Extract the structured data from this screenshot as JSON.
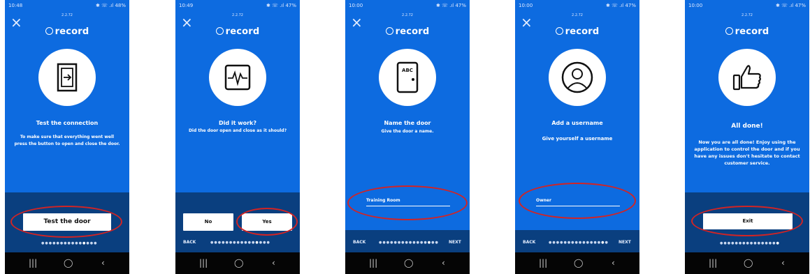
{
  "status_bar": {
    "signal_text": "✱ ☏ .ıl"
  },
  "logo_text": "record",
  "screens": [
    {
      "time": "10:48",
      "battery": "48%",
      "version": "2.2.72",
      "title": "Test the connection",
      "description": "To make sure that everything went well press the button to open and close the door.",
      "button": "Test the door"
    },
    {
      "time": "10:49",
      "battery": "47%",
      "version": "2.2.72",
      "title": "Did it work?",
      "description": "Did the door open and close as it should?",
      "no_button": "No",
      "yes_button": "Yes",
      "back": "BACK"
    },
    {
      "time": "10:00",
      "battery": "47%",
      "version": "2.2.72",
      "title": "Name the door",
      "description": "Give the door a name.",
      "door_label": "ABC",
      "input_value": "Training Room",
      "back": "BACK",
      "next": "NEXT"
    },
    {
      "time": "10:00",
      "battery": "47%",
      "version": "2.2.72",
      "title": "Add a username",
      "description": "Give yourself a username",
      "input_value": "Owner",
      "back": "BACK",
      "next": "NEXT"
    },
    {
      "time": "10:00",
      "battery": "47%",
      "version": "2.2.72",
      "title": "All done!",
      "description": "Now you are all done! Enjoy using the application to control the door and if you have any issues don't hesitate to contact customer service.",
      "button": "Exit"
    }
  ],
  "sys_nav": {
    "recent": "|||",
    "home": "◯",
    "back": "‹"
  },
  "colors": {
    "primary_blue": "#0d6be0",
    "dark_blue": "#0a3f7f",
    "highlight_red": "#d22424"
  }
}
